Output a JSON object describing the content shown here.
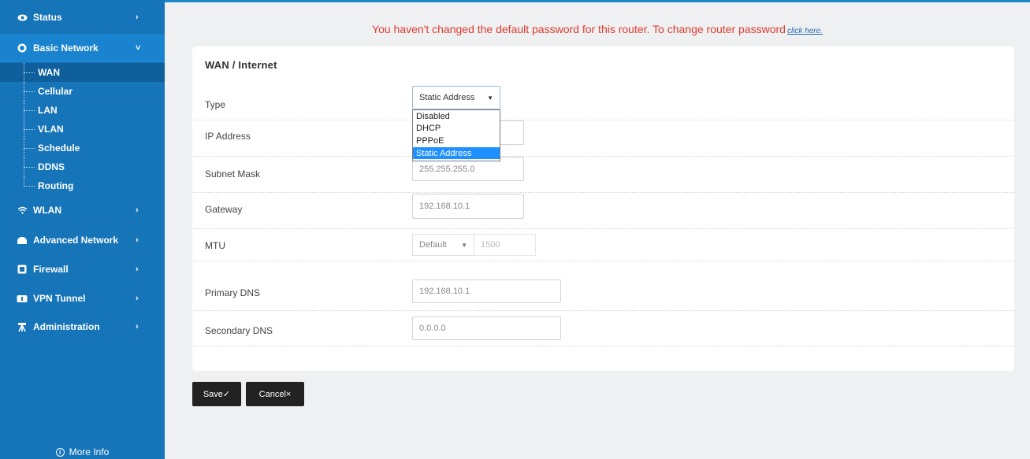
{
  "sidebar": {
    "items": [
      {
        "label": "Status",
        "icon": "eye-icon",
        "chevron": "›"
      },
      {
        "label": "Basic Network",
        "icon": "globe-icon",
        "chevron": "˅"
      },
      {
        "label": "WLAN",
        "icon": "wifi-icon",
        "chevron": "›"
      },
      {
        "label": "Advanced Network",
        "icon": "cloud-icon",
        "chevron": "›"
      },
      {
        "label": "Firewall",
        "icon": "firewall-icon",
        "chevron": "›"
      },
      {
        "label": "VPN Tunnel",
        "icon": "vpn-icon",
        "chevron": "›"
      },
      {
        "label": "Administration",
        "icon": "admin-icon",
        "chevron": "›"
      }
    ],
    "subitems": [
      "WAN",
      "Cellular",
      "LAN",
      "VLAN",
      "Schedule",
      "DDNS",
      "Routing"
    ],
    "more_info": "More Info",
    "accent_color": "#1674b8"
  },
  "warning": {
    "text": "You haven't changed the default password for this router. To change router password",
    "link": "click here."
  },
  "form": {
    "title": "WAN / Internet",
    "type": {
      "label": "Type",
      "value": "Static Address",
      "options": [
        "Disabled",
        "DHCP",
        "PPPoE",
        "Static Address"
      ]
    },
    "ip_address": {
      "label": "IP Address",
      "value": ""
    },
    "subnet_mask": {
      "label": "Subnet Mask",
      "value": "255.255.255.0"
    },
    "gateway": {
      "label": "Gateway",
      "value": "192.168.10.1"
    },
    "mtu": {
      "label": "MTU",
      "mode": "Default",
      "value": "1500"
    },
    "primary_dns": {
      "label": "Primary DNS",
      "value": "192.168.10.1"
    },
    "secondary_dns": {
      "label": "Secondary DNS",
      "value": "0.0.0.0"
    }
  },
  "buttons": {
    "save": "Save✓",
    "cancel": "Cancel×"
  }
}
